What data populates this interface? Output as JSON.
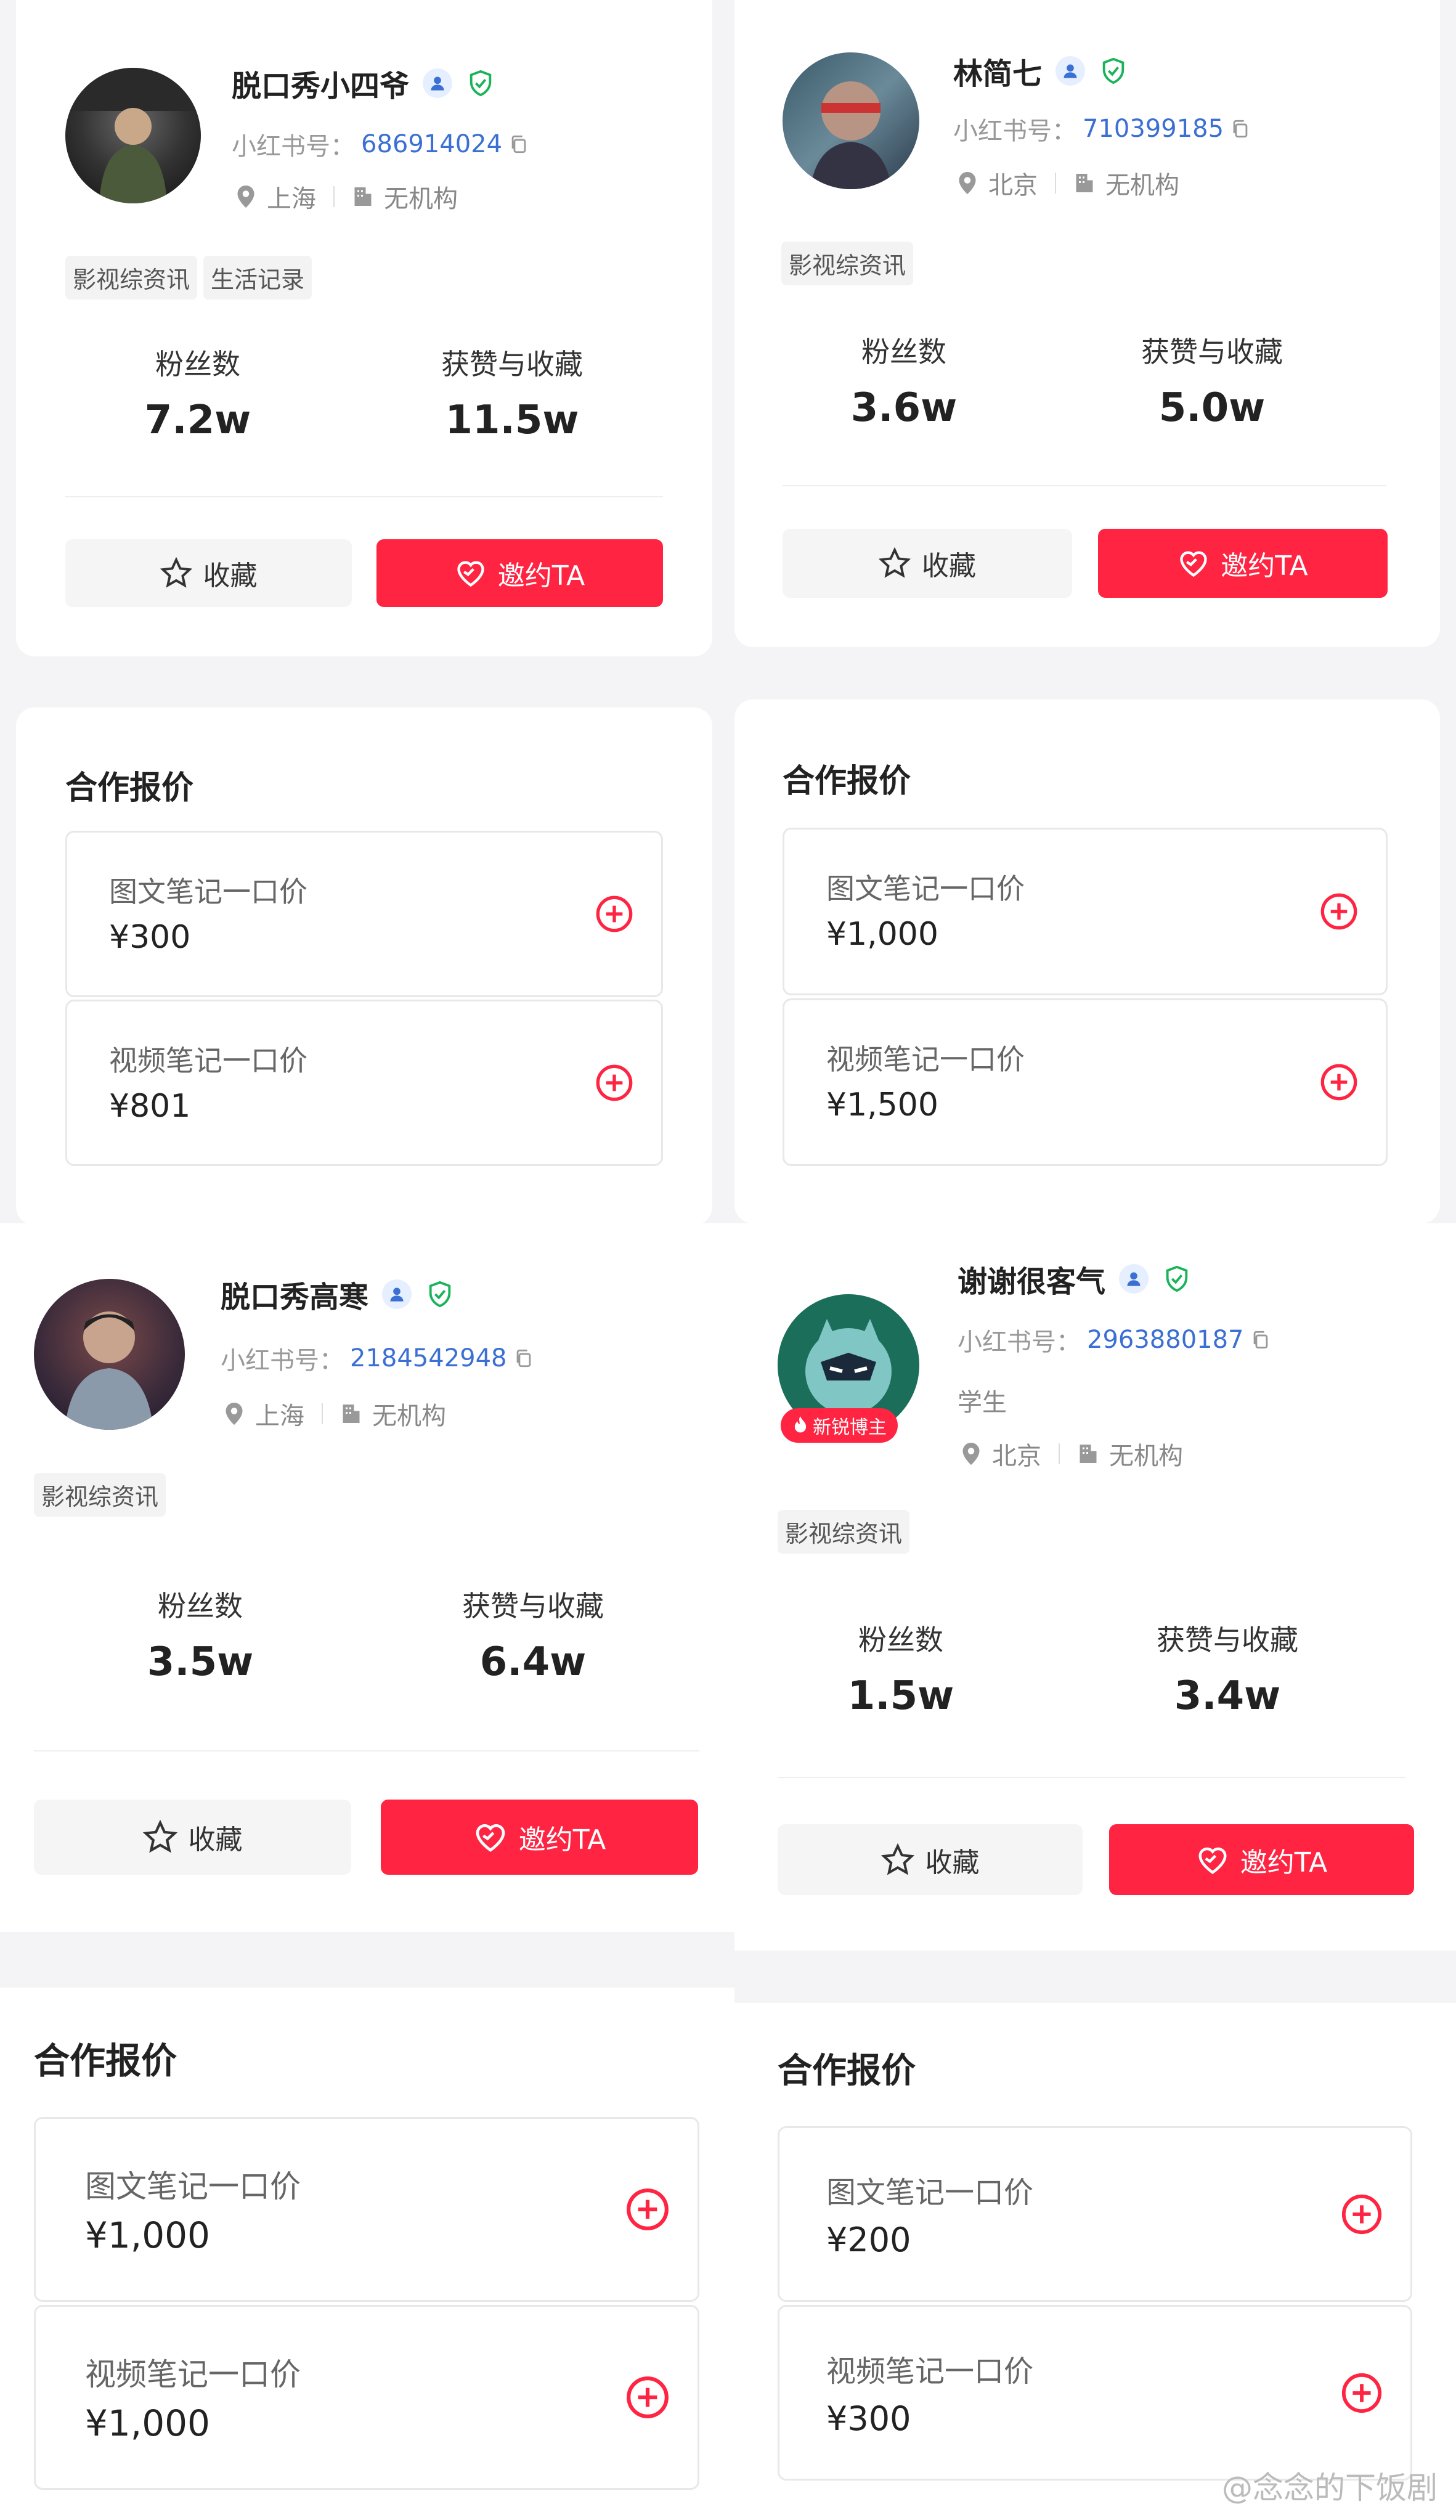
{
  "common": {
    "id_label": "小红书号：",
    "fans_label": "粉丝数",
    "likes_label": "获赞与收藏",
    "fav_button": "收藏",
    "invite_button": "邀约TA",
    "pricing_title": "合作报价",
    "image_note_label": "图文笔记一口价",
    "video_note_label": "视频笔记一口价",
    "org": "无机构"
  },
  "profiles": [
    {
      "name": "脱口秀小四爷",
      "id": "686914024",
      "location": "上海",
      "tags": [
        "影视综资讯",
        "生活记录"
      ],
      "fans": "7.2w",
      "likes": "11.5w",
      "image_price": "¥300",
      "video_price": "¥801"
    },
    {
      "name": "林简七",
      "id": "710399185",
      "location": "北京",
      "tags": [
        "影视综资讯"
      ],
      "fans": "3.6w",
      "likes": "5.0w",
      "image_price": "¥1,000",
      "video_price": "¥1,500"
    },
    {
      "name": "脱口秀高寒",
      "id": "2184542948",
      "location": "上海",
      "tags": [
        "影视综资讯"
      ],
      "fans": "3.5w",
      "likes": "6.4w",
      "image_price": "¥1,000",
      "video_price": "¥1,000"
    },
    {
      "name": "谢谢很客气",
      "id": "2963880187",
      "role": "学生",
      "hot_badge": "新锐博主",
      "location": "北京",
      "tags": [
        "影视综资讯"
      ],
      "fans": "1.5w",
      "likes": "3.4w",
      "image_price": "¥200",
      "video_price": "¥300"
    }
  ],
  "watermark": "@念念的下饭剧",
  "colors": {
    "accent": "#ff2442",
    "link": "#3b6fd3",
    "verify": "#19b35a"
  }
}
